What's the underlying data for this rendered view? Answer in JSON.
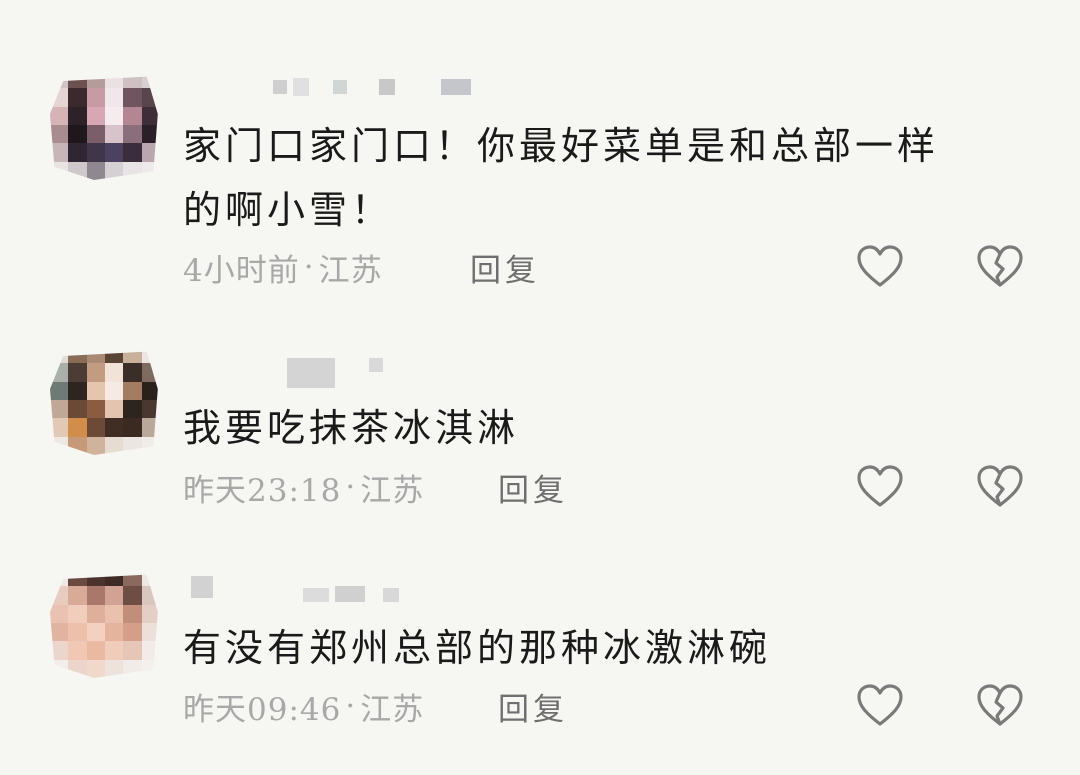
{
  "comments": [
    {
      "text_line1": "家门口家门口！你最好菜单是和总部一样",
      "text_line2": "的啊小雪！",
      "time": "4小时前",
      "location": "江苏",
      "reply_label": "回复",
      "like_icon": "heart-outline-icon",
      "dislike_icon": "broken-heart-icon"
    },
    {
      "text_line1": "我要吃抹茶冰淇淋",
      "time": "昨天23:18",
      "location": "江苏",
      "reply_label": "回复",
      "like_icon": "heart-outline-icon",
      "dislike_icon": "broken-heart-icon"
    },
    {
      "text_line1": "有没有郑州总部的那种冰激淋碗",
      "time": "昨天09:46",
      "location": "江苏",
      "reply_label": "回复",
      "like_icon": "heart-outline-icon",
      "dislike_icon": "broken-heart-icon"
    }
  ],
  "meta_separator": "·",
  "colors": {
    "background": "#f6f6f3",
    "text": "#1a1a1a",
    "meta": "#a8a8a8",
    "icon": "#7a7a7a"
  }
}
